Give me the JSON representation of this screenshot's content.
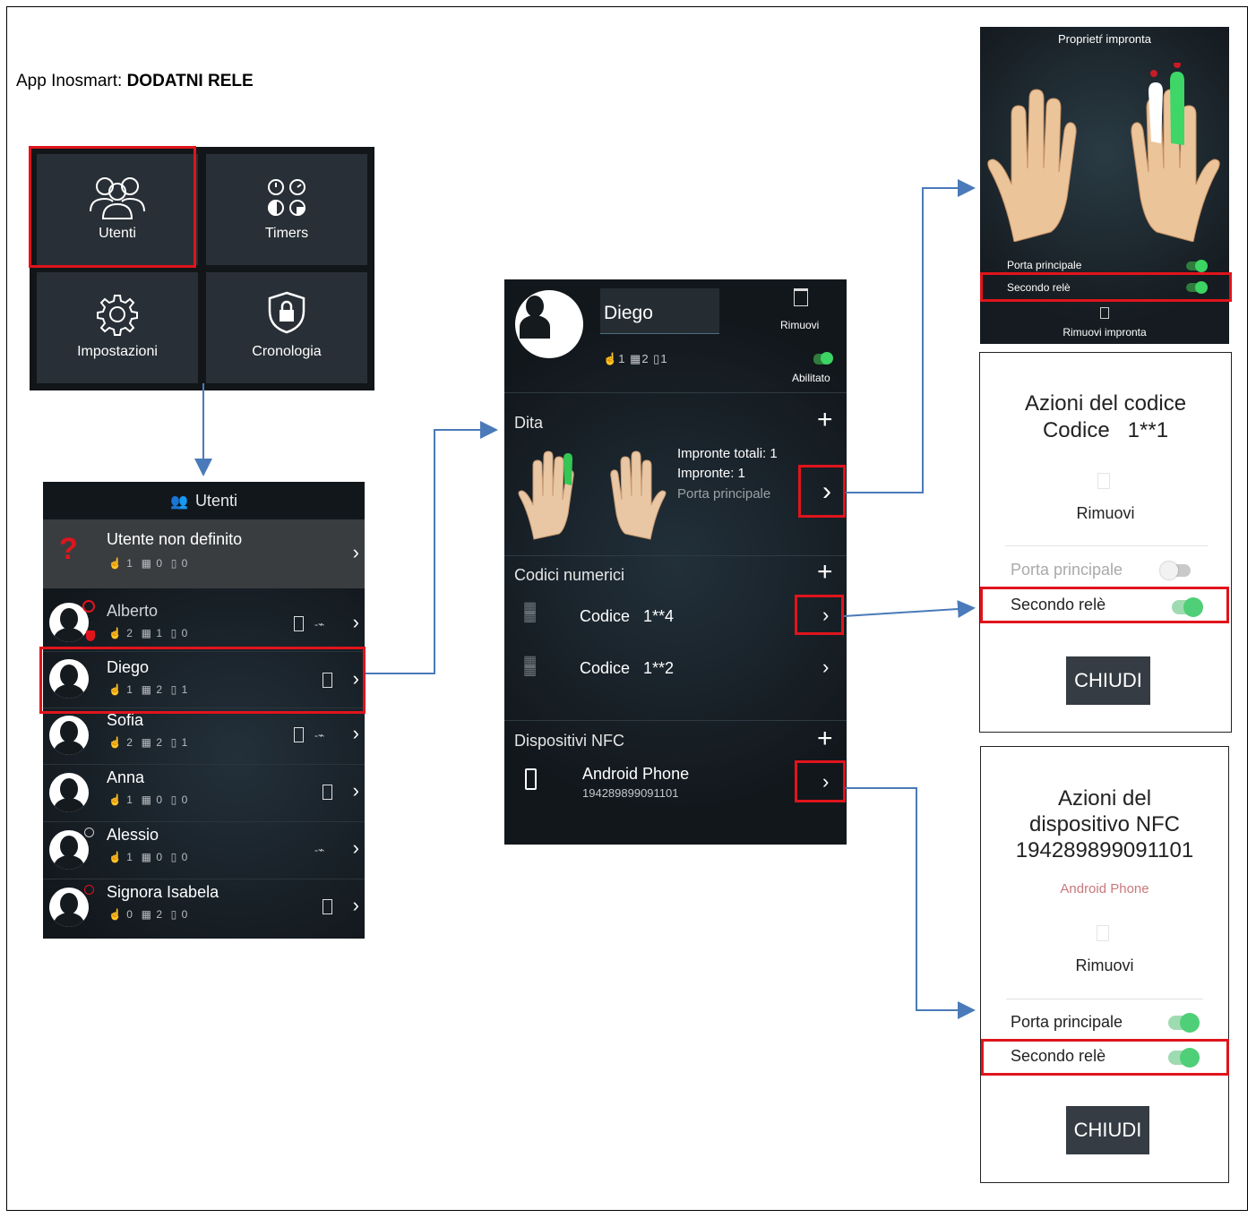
{
  "caption": {
    "prefix": "App Inosmart: ",
    "bold": "DODATNI RELE"
  },
  "menu": {
    "tiles": [
      {
        "label": "Utenti",
        "icon": "users-icon"
      },
      {
        "label": "Timers",
        "icon": "timers-icon"
      },
      {
        "label": "Impostazioni",
        "icon": "gear-icon"
      },
      {
        "label": "Cronologia",
        "icon": "shield-lock-icon"
      }
    ]
  },
  "users_screen": {
    "header": "Utenti",
    "undefined_user": {
      "name": "Utente non definito",
      "fingers": "1",
      "codes": "0",
      "nfc": "0"
    },
    "users": [
      {
        "name": "Alberto",
        "fingers": "2",
        "codes": "1",
        "nfc": "0"
      },
      {
        "name": "Diego",
        "fingers": "1",
        "codes": "2",
        "nfc": "1"
      },
      {
        "name": "Sofia",
        "fingers": "2",
        "codes": "2",
        "nfc": "1"
      },
      {
        "name": "Anna",
        "fingers": "1",
        "codes": "0",
        "nfc": "0"
      },
      {
        "name": "Alessio",
        "fingers": "1",
        "codes": "0",
        "nfc": "0"
      },
      {
        "name": "Signora Isabela",
        "fingers": "0",
        "codes": "2",
        "nfc": "0"
      }
    ]
  },
  "detail_screen": {
    "user_name": "Diego",
    "stats": {
      "fingers": "1",
      "codes": "2",
      "nfc": "1"
    },
    "remove_label": "Rimuovi",
    "enabled_label": "Abilitato",
    "fingers_section": {
      "title": "Dita",
      "total_label": "Impronte totali:  1",
      "prints_label": "Impronte: 1",
      "door_label": "Porta principale"
    },
    "codes_section": {
      "title": "Codici numerici",
      "codes": [
        "Codice   1**4",
        "Codice   1**2"
      ]
    },
    "nfc_section": {
      "title": "Dispositivi NFC",
      "device_name": "Android Phone",
      "device_id": "194289899091101"
    }
  },
  "fingerprint_props": {
    "title": "Proprietŕ impronta",
    "main_door": "Porta principale",
    "second_relay": "Secondo relè",
    "remove": "Rimuovi impronta"
  },
  "code_dialog": {
    "title_line1": "Azioni del codice",
    "title_line2": "Codice   1**1",
    "remove": "Rimuovi",
    "main_door": "Porta principale",
    "second_relay": "Secondo relè",
    "close": "CHIUDI"
  },
  "nfc_dialog": {
    "title_line1": "Azioni del",
    "title_line2": "dispositivo NFC",
    "title_line3": "194289899091101",
    "subtitle": "Android Phone",
    "remove": "Rimuovi",
    "main_door": "Porta principale",
    "second_relay": "Secondo relè",
    "close": "CHIUDI"
  },
  "colors": {
    "highlight": "#e0141c",
    "arrow": "#4a7ab9",
    "toggle_on": "#3cd463"
  }
}
